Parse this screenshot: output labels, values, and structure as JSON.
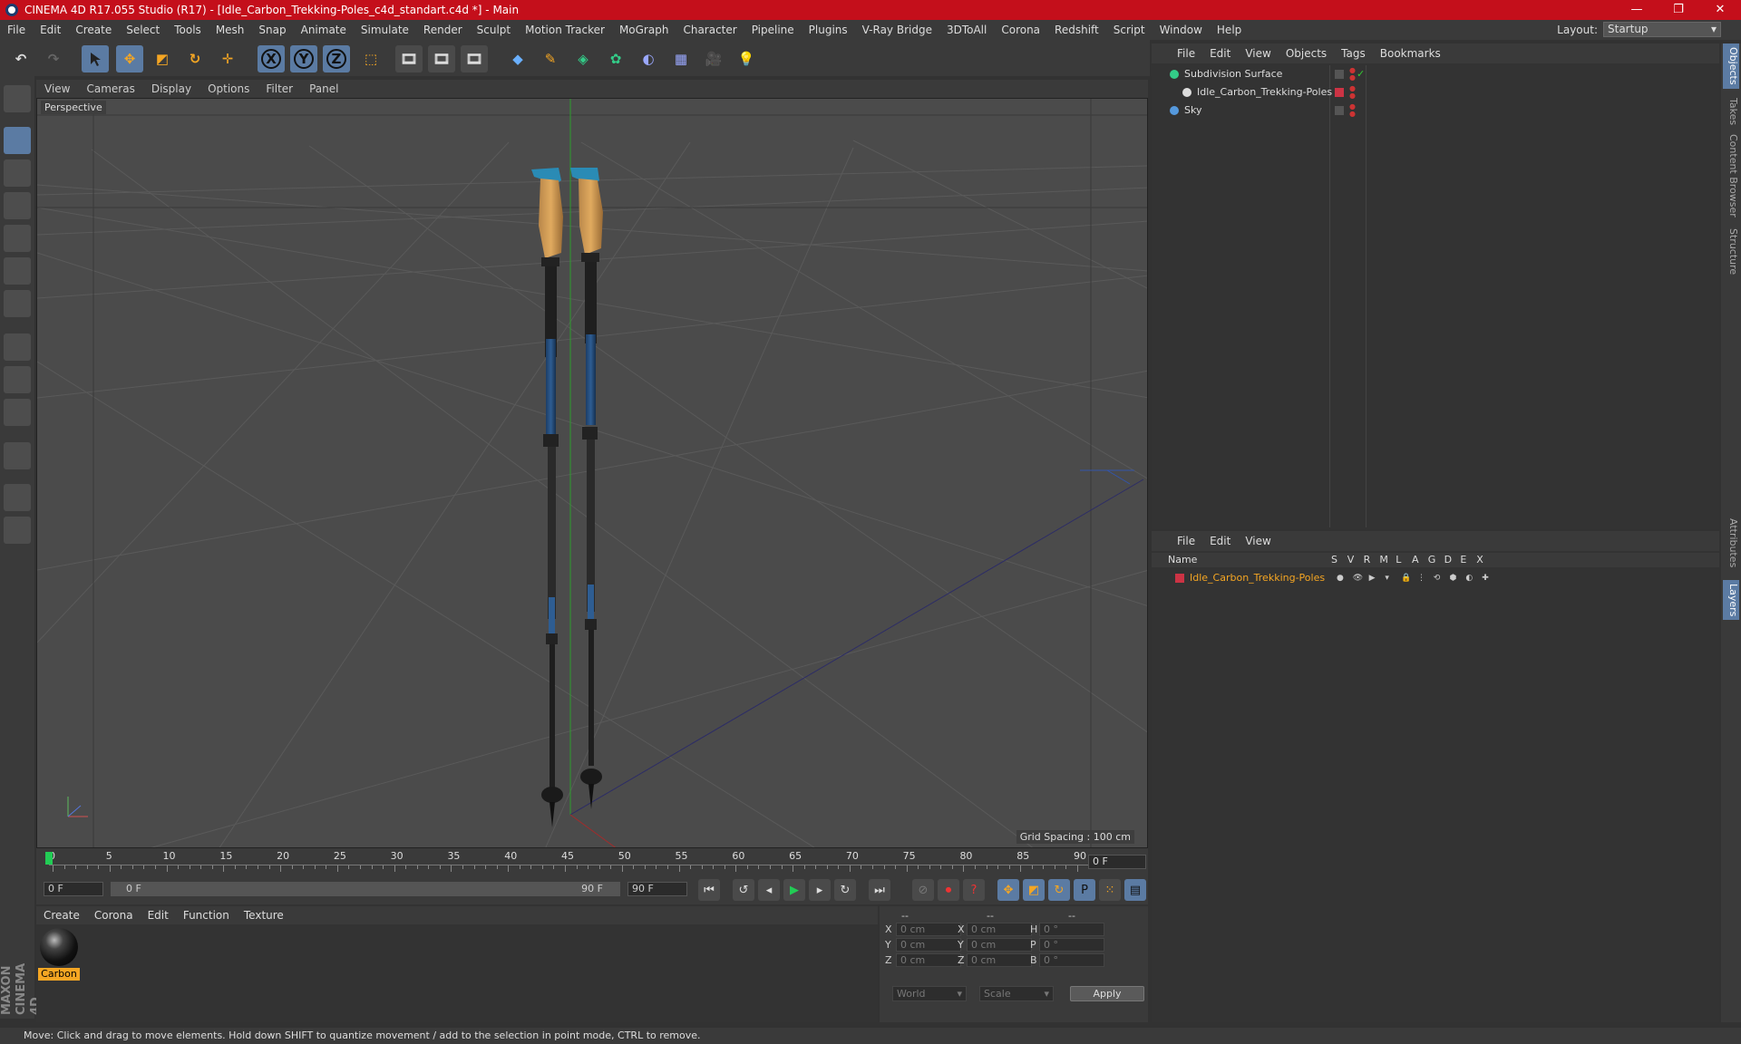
{
  "title_bar": {
    "text": "CINEMA 4D R17.055 Studio (R17) - [Idle_Carbon_Trekking-Poles_c4d_standart.c4d *] - Main",
    "min": "—",
    "max": "❐",
    "close": "✕"
  },
  "menu": [
    "File",
    "Edit",
    "Create",
    "Select",
    "Tools",
    "Mesh",
    "Snap",
    "Animate",
    "Simulate",
    "Render",
    "Sculpt",
    "Motion Tracker",
    "MoGraph",
    "Character",
    "Pipeline",
    "Plugins",
    "V-Ray Bridge",
    "3DToAll",
    "Corona",
    "Redshift",
    "Script",
    "Window",
    "Help"
  ],
  "layout": {
    "label": "Layout:",
    "value": "Startup"
  },
  "axis_buttons": [
    "X",
    "Y",
    "Z"
  ],
  "viewport": {
    "menu": [
      "View",
      "Cameras",
      "Display",
      "Options",
      "Filter",
      "Panel"
    ],
    "label": "Perspective",
    "grid_spacing": "Grid Spacing : 100 cm"
  },
  "timeline": {
    "ticks": [
      "0",
      "5",
      "10",
      "15",
      "20",
      "25",
      "30",
      "35",
      "40",
      "45",
      "50",
      "55",
      "60",
      "65",
      "70",
      "75",
      "80",
      "85",
      "90"
    ],
    "current_frame": "0 F",
    "start_field": "0 F",
    "range_start": "0 F",
    "range_end": "90 F",
    "end_field": "90 F"
  },
  "material": {
    "menu": [
      "Create",
      "Corona",
      "Edit",
      "Function",
      "Texture"
    ],
    "name": "Carbon"
  },
  "coords": {
    "headers": [
      "--",
      "--",
      "--"
    ],
    "rows": [
      {
        "l1": "X",
        "v1": "0 cm",
        "l2": "X",
        "v2": "0 cm",
        "l3": "H",
        "v3": "0 °"
      },
      {
        "l1": "Y",
        "v1": "0 cm",
        "l2": "Y",
        "v2": "0 cm",
        "l3": "P",
        "v3": "0 °"
      },
      {
        "l1": "Z",
        "v1": "0 cm",
        "l2": "Z",
        "v2": "0 cm",
        "l3": "B",
        "v3": "0 °"
      }
    ],
    "mode": "World",
    "scale": "Scale",
    "apply": "Apply"
  },
  "objects": {
    "menu": [
      "File",
      "Edit",
      "View",
      "Objects",
      "Tags",
      "Bookmarks"
    ],
    "items": [
      {
        "name": "Subdivision Surface",
        "color": "#33cc88"
      },
      {
        "name": "Idle_Carbon_Trekking-Poles",
        "color": "#cc3344"
      },
      {
        "name": "Sky",
        "color": "#5599dd"
      }
    ]
  },
  "layers": {
    "menu": [
      "File",
      "Edit",
      "View"
    ],
    "columns": [
      "Name",
      "S",
      "V",
      "R",
      "M",
      "L",
      "A",
      "G",
      "D",
      "E",
      "X"
    ],
    "items": [
      {
        "name": "Idle_Carbon_Trekking-Poles",
        "color": "#cc3344"
      }
    ]
  },
  "right_tabs": [
    "Objects",
    "Takes",
    "Content Browser",
    "Structure",
    "Attributes",
    "Layers"
  ],
  "status": "Move: Click and drag to move elements. Hold down SHIFT to quantize movement / add to the selection in point mode, CTRL to remove.",
  "brand": "MAXON CINEMA 4D"
}
